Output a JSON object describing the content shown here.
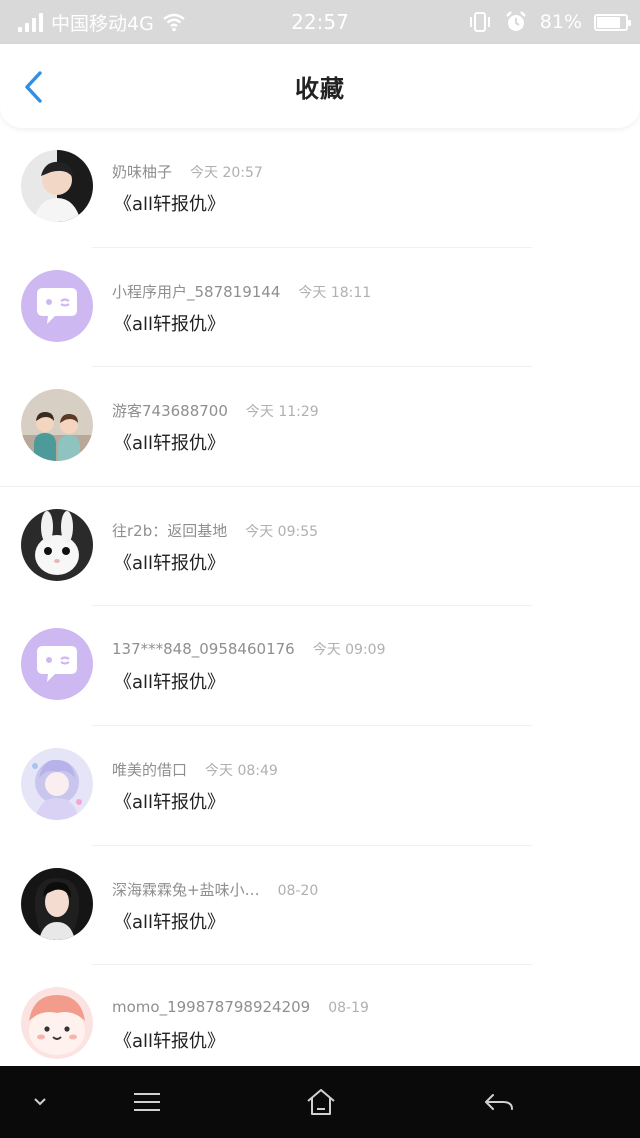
{
  "status_bar": {
    "carrier": "中国移动4G",
    "time": "22:57",
    "battery": "81%",
    "battery_level": 0.81
  },
  "header": {
    "title": "收藏"
  },
  "favorites": [
    {
      "name": "奶味柚子",
      "time": "今天 20:57",
      "title": "《all轩报仇》",
      "avatar": "person-avatar"
    },
    {
      "name": "小程序用户_587819144",
      "time": "今天 18:11",
      "title": "《all轩报仇》",
      "avatar": "chat-bubble-avatar"
    },
    {
      "name": "游客743688700",
      "time": "今天 11:29",
      "title": "《all轩报仇》",
      "avatar": "kids-avatar"
    },
    {
      "name": "往r2b：返回基地",
      "time": "今天 09:55",
      "title": "《all轩报仇》",
      "avatar": "rabbit-avatar"
    },
    {
      "name": "137***848_0958460176",
      "time": "今天 09:09",
      "title": "《all轩报仇》",
      "avatar": "chat-bubble-avatar"
    },
    {
      "name": "唯美的借口",
      "time": "今天 08:49",
      "title": "《all轩报仇》",
      "avatar": "anime-girl-avatar"
    },
    {
      "name": "深海霖霖兔+盐味小…",
      "time": "08-20",
      "title": "《all轩报仇》",
      "avatar": "girl-avatar"
    },
    {
      "name": "momo_199878798924209",
      "time": "08-19",
      "title": "《all轩报仇》",
      "avatar": "cartoon-face-avatar"
    }
  ],
  "colors": {
    "accent": "#2f8fe6",
    "chat_avatar_bg": "#cdb8f2",
    "status_bar_bg": "#d9d9d9",
    "nav_bar_bg": "#0a0a0a"
  },
  "nav_bar": {
    "buttons": [
      "chevron-down-icon",
      "menu-icon",
      "home-icon",
      "back-arrow-icon"
    ]
  }
}
